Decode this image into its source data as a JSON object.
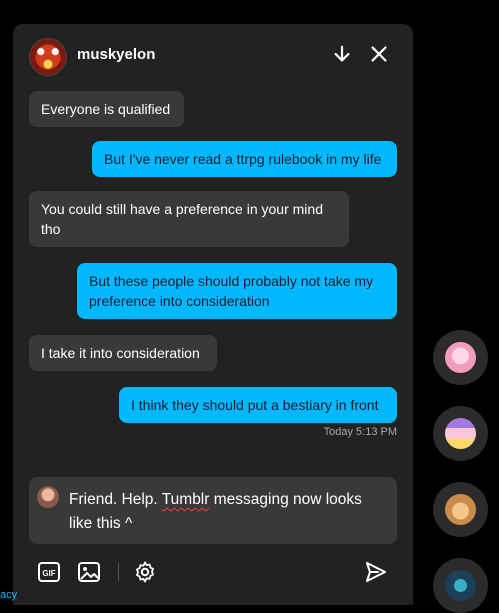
{
  "header": {
    "username": "muskyelon"
  },
  "messages": [
    {
      "from": "them",
      "text": "Everyone is qualified"
    },
    {
      "from": "me",
      "text": "But I've never read a ttrpg rulebook in my life"
    },
    {
      "from": "them",
      "text": "You could still have a preference in your mind tho"
    },
    {
      "from": "me",
      "text": "But these people should probably not take my preference into consideration"
    },
    {
      "from": "them",
      "text": "I take it into consideration"
    },
    {
      "from": "me",
      "text": "I think they should put a bestiary in front"
    }
  ],
  "timestamp": "Today 5:13 PM",
  "composer": {
    "before": "Friend. Help. ",
    "misspelled": "Tumblr",
    "after": " messaging now looks like this ^"
  },
  "toolbar": {
    "gif_label": "GIF"
  },
  "corner_text": "acy",
  "colors": {
    "accent": "#00b8ff",
    "panel": "#222222",
    "bubble_them": "#393939"
  }
}
